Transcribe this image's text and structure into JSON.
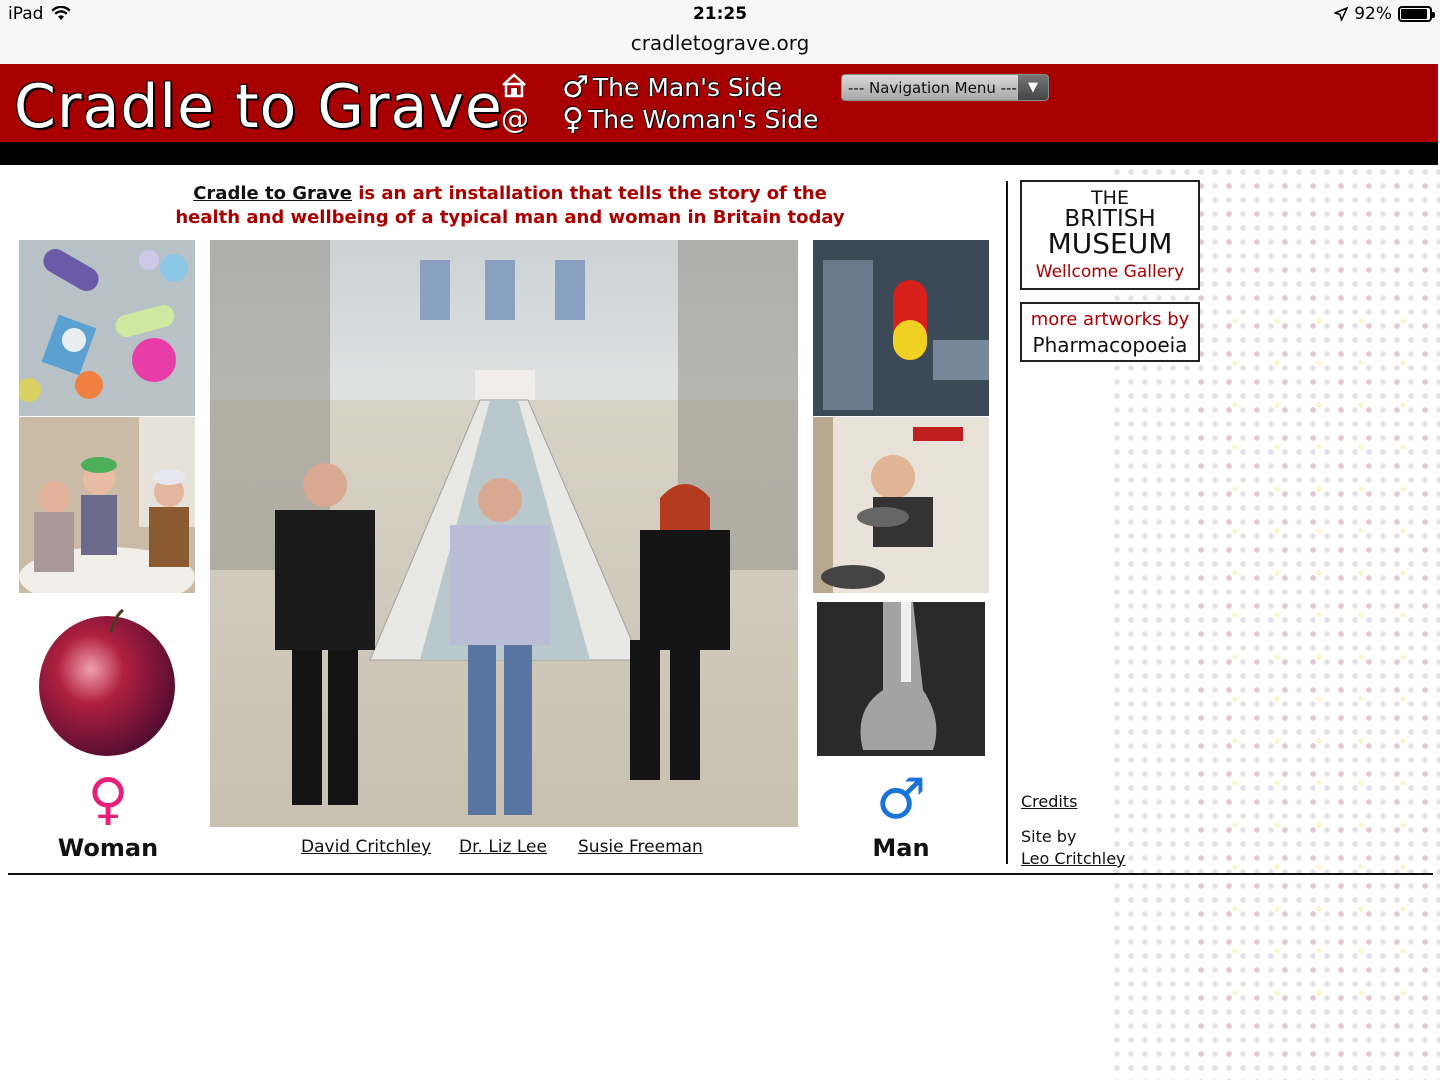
{
  "status_bar": {
    "device": "iPad",
    "time": "21:25",
    "battery": "92%",
    "battery_level": 0.92
  },
  "address_bar": {
    "url": "cradletograve.org"
  },
  "header": {
    "title": "Cradle to Grave",
    "mans_side": "The Man's Side",
    "womans_side": "The Woman's Side",
    "nav_menu": "--- Navigation Menu ---",
    "male_symbol": "♂",
    "female_symbol": "♀",
    "home_icon": "home-icon",
    "email_icon": "@"
  },
  "intro": {
    "title_link": "Cradle to Grave",
    "text_1": " is an art installation that tells the story of the",
    "text_2": "health and wellbeing of a typical man and woman in Britain today"
  },
  "woman": {
    "symbol": "♀",
    "label": "Woman",
    "color": "#e8207a"
  },
  "man": {
    "symbol": "♂",
    "label": "Man",
    "color": "#1a73d8"
  },
  "artists": [
    "David Critchley",
    "Dr. Liz Lee",
    "Susie Freeman"
  ],
  "sidebar": {
    "bm_the": "THE",
    "bm_british": "BRITISH",
    "bm_museum": "MUSEUM",
    "bm_wellcome": "Wellcome Gallery",
    "pharma_1": "more artworks by",
    "pharma_2": "Pharmacopoeia",
    "credits": "Credits",
    "siteby": "Site by",
    "siteby_link": "Leo Critchley"
  },
  "colors": {
    "header_red": "#a80000",
    "accent_red": "#a80000"
  }
}
